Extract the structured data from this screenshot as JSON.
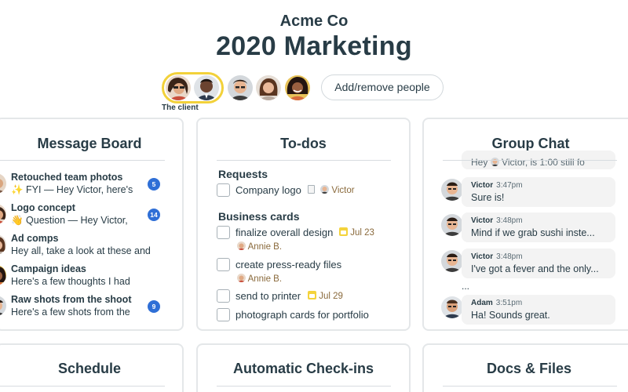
{
  "header": {
    "company": "Acme Co",
    "project": "2020 Marketing",
    "client_label": "The client",
    "add_people_label": "Add/remove people"
  },
  "message_board": {
    "title": "Message Board",
    "messages": [
      {
        "title": "Retouched team photos",
        "snippet": "✨ FYI — Hey Victor, here's",
        "badge": "5"
      },
      {
        "title": "Logo concept",
        "snippet": "👋 Question — Hey Victor,",
        "badge": "14"
      },
      {
        "title": "Ad comps",
        "snippet": "Hey all, take a look at these and",
        "badge": ""
      },
      {
        "title": "Campaign ideas",
        "snippet": "Here's a few thoughts I had",
        "badge": ""
      },
      {
        "title": "Raw shots from the shoot",
        "snippet": "Here's a few shots from the",
        "badge": "9"
      }
    ]
  },
  "todos": {
    "title": "To-dos",
    "lists": [
      {
        "name": "Requests",
        "items": [
          {
            "label": "Company logo",
            "assignee": "Victor",
            "due": ""
          }
        ]
      },
      {
        "name": "Business cards",
        "items": [
          {
            "label": "finalize overall design",
            "due": "Jul 23",
            "assignee": "Annie B."
          },
          {
            "label": "create press-ready files",
            "due": "",
            "assignee": "Annie B."
          },
          {
            "label": "send to printer",
            "due": "Jul 29",
            "assignee": ""
          },
          {
            "label": "photograph cards for portfolio",
            "due": "",
            "assignee": ""
          }
        ]
      }
    ]
  },
  "group_chat": {
    "title": "Group Chat",
    "partial_top": "Hey",
    "partial_top_name": "Victor, is 1:00 still fo",
    "messages": [
      {
        "name": "Victor",
        "time": "3:47pm",
        "text": "Sure is!"
      },
      {
        "name": "Victor",
        "time": "3:48pm",
        "text": "Mind if we grab sushi inste..."
      },
      {
        "name": "Victor",
        "time": "3:48pm",
        "text": "I've got a fever and the only..."
      },
      {
        "name": "Adam",
        "time": "3:51pm",
        "text": "Ha! Sounds great."
      }
    ],
    "ellipsis": "..."
  },
  "bottom_cards": {
    "schedule": "Schedule",
    "checkins": "Automatic Check-ins",
    "docs": "Docs & Files"
  },
  "colors": {
    "client_ring": "#f2d13a",
    "badge": "#2f6fd6",
    "due_icon": "#f4d33c",
    "card_border": "#e4e7e9"
  }
}
